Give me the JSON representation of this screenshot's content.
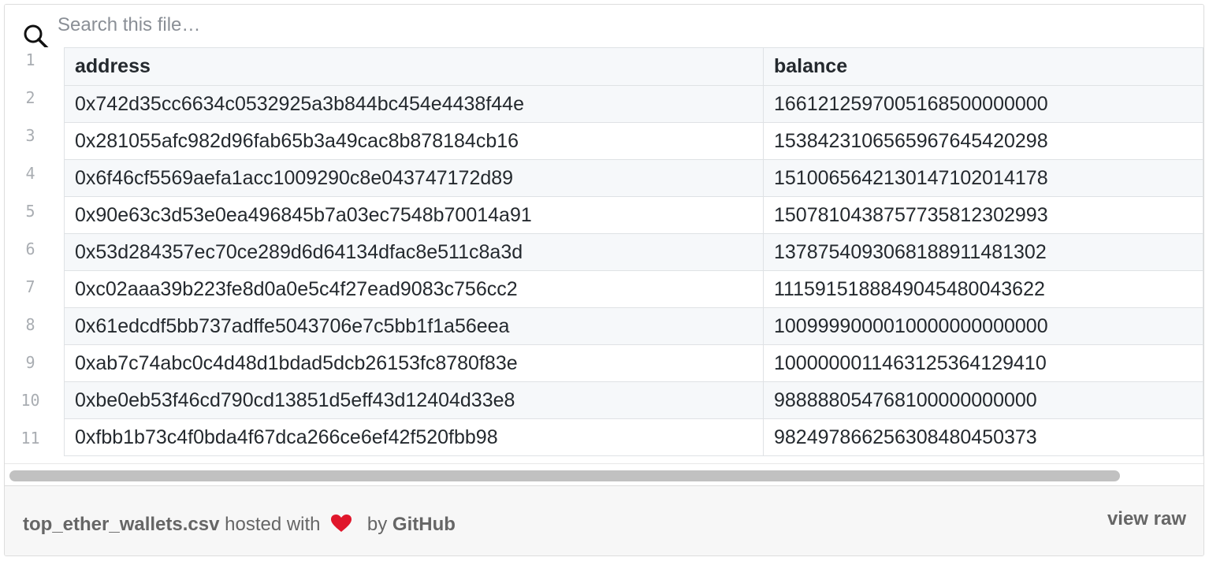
{
  "search": {
    "placeholder": "Search this file…",
    "value": ""
  },
  "gutter": {
    "line_numbers": [
      "1",
      "2",
      "3",
      "4",
      "5",
      "6",
      "7",
      "8",
      "9",
      "10",
      "11"
    ]
  },
  "table": {
    "columns": [
      "address",
      "balance"
    ],
    "rows": [
      [
        "0x742d35cc6634c0532925a3b844bc454e4438f44e",
        "1661212597005168500000000"
      ],
      [
        "0x281055afc982d96fab65b3a49cac8b878184cb16",
        "1538423106565967645420298"
      ],
      [
        "0x6f46cf5569aefa1acc1009290c8e043747172d89",
        "1510065642130147102014178"
      ],
      [
        "0x90e63c3d53e0ea496845b7a03ec7548b70014a91",
        "1507810438757735812302993"
      ],
      [
        "0x53d284357ec70ce289d6d64134dfac8e511c8a3d",
        "1378754093068188911481302"
      ],
      [
        "0xc02aaa39b223fe8d0a0e5c4f27ead9083c756cc2",
        "1115915188849045480043622"
      ],
      [
        "0x61edcdf5bb737adffe5043706e7c5bb1f1a56eea",
        "1009999000010000000000000"
      ],
      [
        "0xab7c74abc0c4d48d1bdad5dcb26153fc8780f83e",
        "1000000011463125364129410"
      ],
      [
        "0xbe0eb53f46cd790cd13851d5eff43d12404d33e8",
        "988888054768100000000000"
      ],
      [
        "0xfbb1b73c4f0bda4f67dca266ce6ef42f520fbb98",
        "982497866256308480450373"
      ]
    ]
  },
  "footer": {
    "filename": "top_ether_wallets.csv",
    "hosted_text": " hosted with",
    "by_text": "by",
    "brand": "GitHub",
    "view_raw_label": "view raw",
    "heart_color": "#e0162b"
  }
}
